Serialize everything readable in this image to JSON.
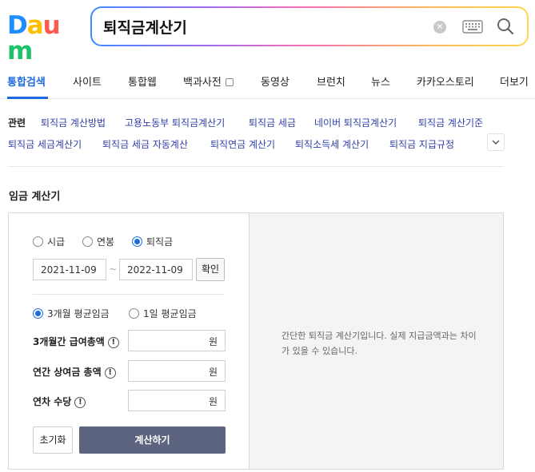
{
  "logo": {
    "text": "Daum",
    "letters": [
      "D",
      "a",
      "u",
      "m"
    ]
  },
  "search": {
    "query": "퇴직금계산기",
    "clear_icon": "close-icon",
    "keyboard_icon": "keyboard-icon",
    "search_icon": "search-icon"
  },
  "tabs": [
    {
      "label": "통합검색",
      "active": true
    },
    {
      "label": "사이트"
    },
    {
      "label": "통합웹"
    },
    {
      "label": "백과사전"
    },
    {
      "label": "동영상"
    },
    {
      "label": "브런치"
    },
    {
      "label": "뉴스"
    },
    {
      "label": "카카오스토리"
    },
    {
      "label": "더보기"
    }
  ],
  "related": {
    "heading": "관련",
    "links": [
      "퇴직금 계산방법",
      "고용노동부 퇴직금계산기",
      "퇴직금 세금",
      "네이버 퇴직금계산기",
      "퇴직금 계산기준",
      "퇴직금 세금계산기",
      "퇴직금 세금 자동계산",
      "퇴직연금 계산기",
      "퇴직소득세 계산기",
      "퇴직금 지급규정"
    ]
  },
  "calculator": {
    "title": "임금 계산기",
    "types": [
      {
        "label": "시급",
        "selected": false
      },
      {
        "label": "연봉",
        "selected": false
      },
      {
        "label": "퇴직금",
        "selected": true
      }
    ],
    "start_date": "2021-11-09",
    "date_separator": "~",
    "end_date": "2022-11-09",
    "confirm_label": "확인",
    "wage_modes": [
      {
        "label": "3개월 평균임금",
        "selected": true
      },
      {
        "label": "1일 평균임금",
        "selected": false
      }
    ],
    "fields": [
      {
        "label": "3개월간 급여총액",
        "unit": "원",
        "value": ""
      },
      {
        "label": "연간 상여금 총액",
        "unit": "원",
        "value": ""
      },
      {
        "label": "연차 수당",
        "unit": "원",
        "value": ""
      }
    ],
    "info_glyph": "!",
    "reset_label": "초기화",
    "submit_label": "계산하기",
    "description": "간단한 퇴직금 계산기입니다. 실제 지급금액과는 차이가 있을 수 있습니다."
  },
  "colors": {
    "accent": "#1a6ae0",
    "link": "#2f3fa8",
    "submit_bg": "#5d647f",
    "result_bg": "#f4f4f4"
  }
}
